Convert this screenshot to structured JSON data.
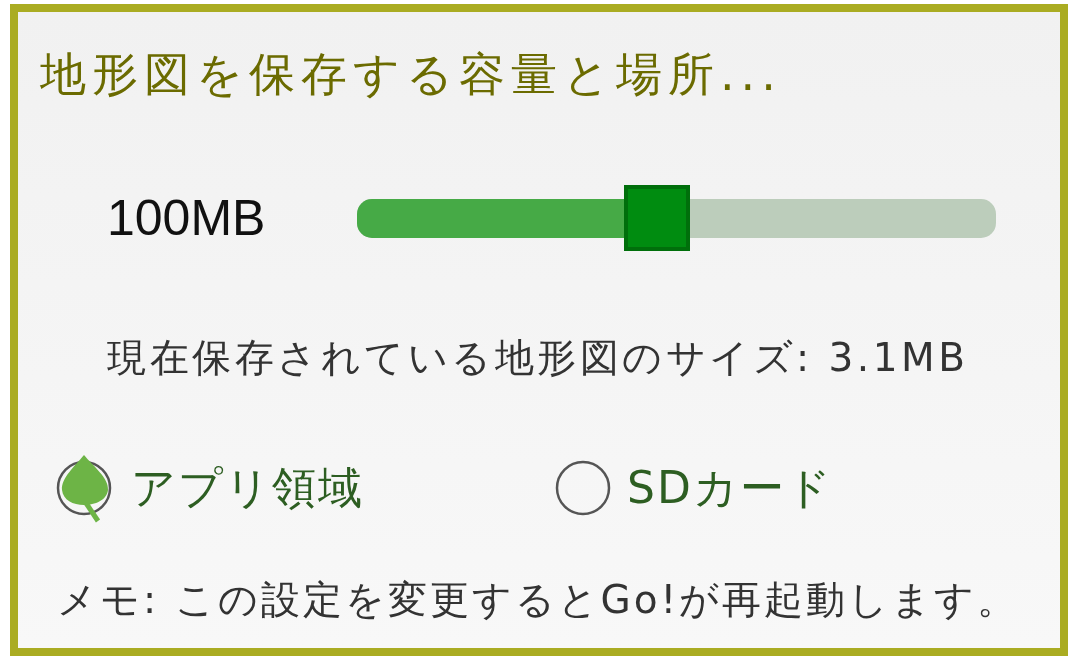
{
  "title": "地形図を保存する容量と場所...",
  "capacity": {
    "value": "100MB",
    "level": 0.47
  },
  "current_size": "現在保存されている地形図のサイズ: 3.1MB",
  "storage_options": [
    {
      "label": "アプリ領域",
      "selected": true
    },
    {
      "label": "SDカード",
      "selected": false
    }
  ],
  "note": "メモ: この設定を変更するとGo!が再起動します。"
}
